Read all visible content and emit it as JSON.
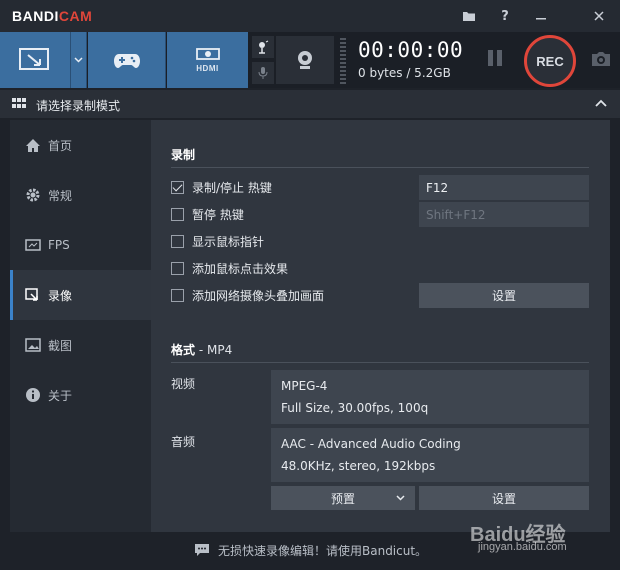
{
  "app": {
    "logo_main": "BANDI",
    "logo_accent": "CAM"
  },
  "titlebar": {
    "icons": [
      "folder-icon",
      "help-icon",
      "minimize-icon",
      "close-icon"
    ]
  },
  "toolbar": {
    "modes": [
      "screen-mode-icon",
      "game-mode-icon",
      "hdmi-mode-icon"
    ],
    "hdmi_label": "HDMI",
    "timer": "00:00:00",
    "size": "0 bytes / 5.2GB",
    "rec_label": "REC"
  },
  "section": {
    "title": "请选择录制模式"
  },
  "sidebar": {
    "items": [
      {
        "label": "首页",
        "icon": "home-icon"
      },
      {
        "label": "常规",
        "icon": "gear-icon"
      },
      {
        "label": "FPS",
        "icon": "fps-icon"
      },
      {
        "label": "录像",
        "icon": "video-icon",
        "active": true
      },
      {
        "label": "截图",
        "icon": "image-icon"
      },
      {
        "label": "关于",
        "icon": "info-icon"
      }
    ]
  },
  "record": {
    "heading": "录制",
    "options": [
      {
        "label": "录制/停止 热键",
        "checked": true
      },
      {
        "label": "暂停 热键",
        "checked": false
      },
      {
        "label": "显示鼠标指针",
        "checked": false
      },
      {
        "label": "添加鼠标点击效果",
        "checked": false
      },
      {
        "label": "添加网络摄像头叠加画面",
        "checked": false
      }
    ],
    "hotkey_record": "F12",
    "hotkey_pause": "Shift+F12",
    "webcam_settings_label": "设置"
  },
  "format": {
    "heading": "格式",
    "container": " - MP4",
    "video_label": "视频",
    "video_codec": "MPEG-4",
    "video_detail": "Full Size, 30.00fps, 100q",
    "audio_label": "音频",
    "audio_codec": "AAC - Advanced Audio Coding",
    "audio_detail": "48.0KHz, stereo, 192kbps",
    "preset_label": "预置",
    "settings_label": "设置"
  },
  "footer": {
    "text": "无损快速录像编辑！请使用Bandicut。"
  },
  "watermark": {
    "brand": "Baidu经验",
    "url": "jingyan.baidu.com"
  },
  "colors": {
    "accent": "#3b6e9f",
    "rec": "#e0463a",
    "background": "#1e2229"
  }
}
